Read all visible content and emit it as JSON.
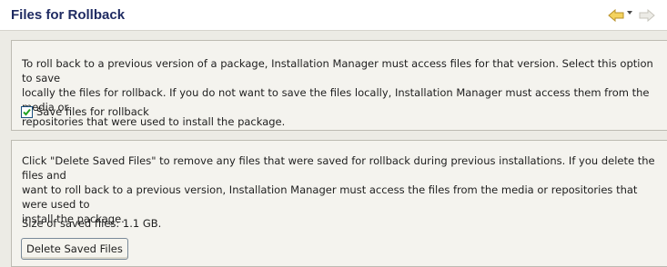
{
  "header": {
    "title": "Files for Rollback",
    "back_icon": "back-arrow-icon",
    "dropdown_icon": "chevron-down-icon",
    "forward_icon": "forward-arrow-icon"
  },
  "rollback_section": {
    "description": "To roll back to a previous version of a package, Installation Manager must access files for that version. Select this option to save\nlocally the files for rollback. If you do not want to save the files locally, Installation Manager must access them from the media or\nrepositories that were used to install the package.",
    "checkbox_label": "Save files for rollback",
    "checkbox_checked": true
  },
  "delete_section": {
    "description": "Click \"Delete Saved Files\" to remove any files that were saved for rollback during previous installations.  If you delete the files and\nwant to roll back to a previous version, Installation Manager must access the files from the media or repositories that were used to\ninstall the package.",
    "size_text": "Size of saved files: 1.1 GB.",
    "button_label": "Delete Saved Files"
  },
  "colors": {
    "title": "#1f2b62",
    "nav_back": "#f2c744",
    "nav_forward": "#d8d6ce",
    "panel_bg": "#ecebe5",
    "section_bg": "#f4f3ee"
  }
}
